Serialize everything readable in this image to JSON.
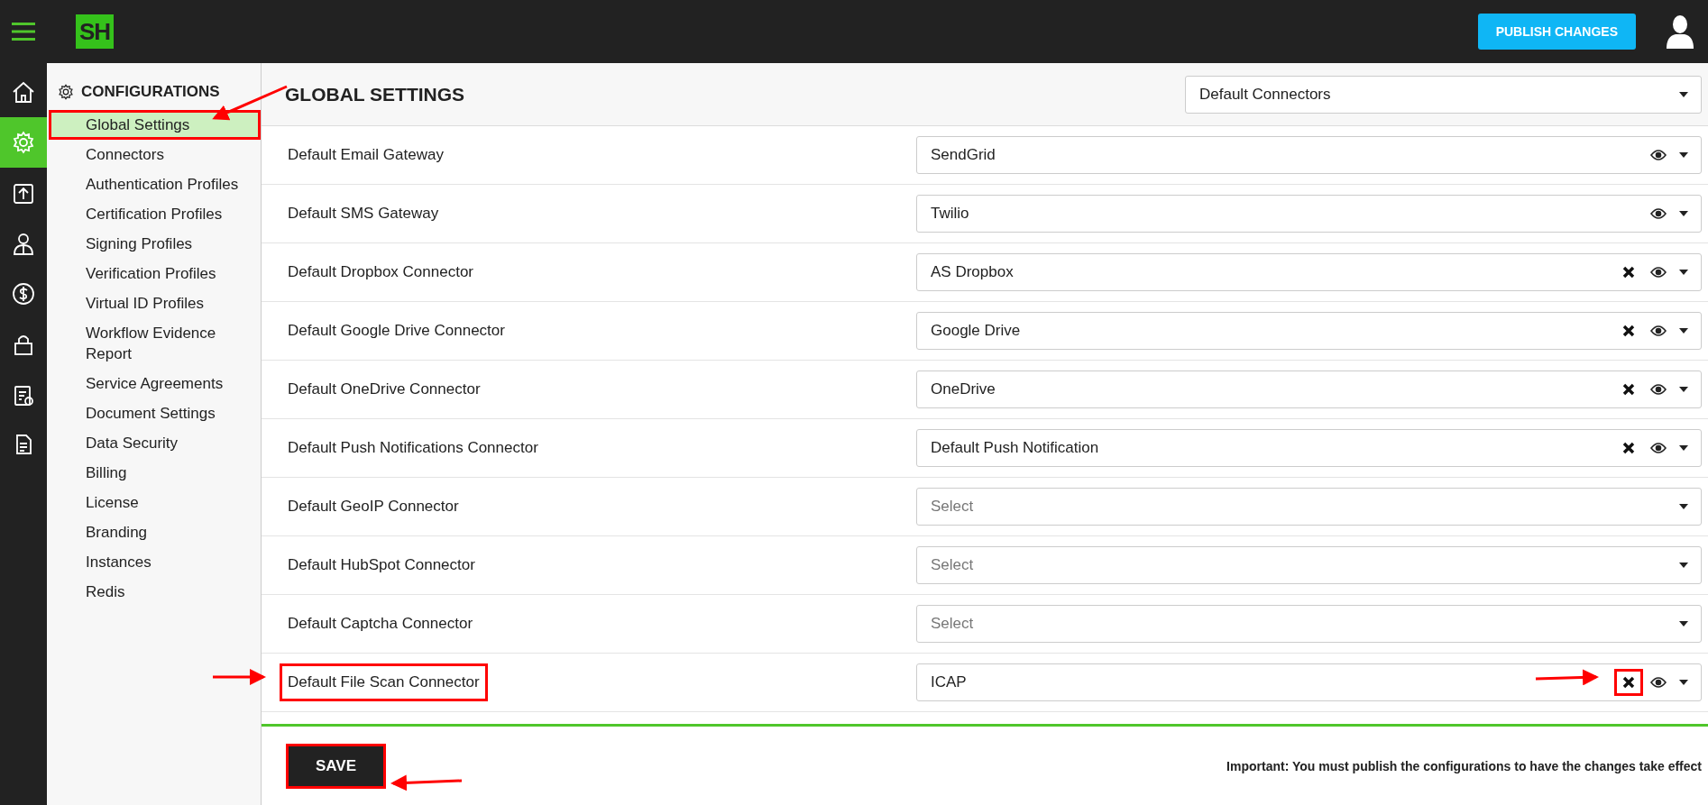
{
  "topbar": {
    "logo": "SH",
    "publish_button": "PUBLISH CHANGES"
  },
  "rail": [
    {
      "selected": false
    },
    {
      "selected": true
    },
    {
      "selected": false
    },
    {
      "selected": false
    },
    {
      "selected": false
    },
    {
      "selected": false
    },
    {
      "selected": false
    },
    {
      "selected": false
    }
  ],
  "sidebar": {
    "title": "CONFIGURATIONS",
    "items": [
      {
        "label": "Global Settings",
        "selected": true,
        "annotated": true
      },
      {
        "label": "Connectors",
        "selected": false,
        "annotated": false
      },
      {
        "label": "Authentication Profiles",
        "selected": false,
        "annotated": false
      },
      {
        "label": "Certification Profiles",
        "selected": false,
        "annotated": false
      },
      {
        "label": "Signing Profiles",
        "selected": false,
        "annotated": false
      },
      {
        "label": "Verification Profiles",
        "selected": false,
        "annotated": false
      },
      {
        "label": "Virtual ID Profiles",
        "selected": false,
        "annotated": false
      },
      {
        "label": "Workflow Evidence Report",
        "selected": false,
        "annotated": false
      },
      {
        "label": "Service Agreements",
        "selected": false,
        "annotated": false
      },
      {
        "label": "Document Settings",
        "selected": false,
        "annotated": false
      },
      {
        "label": "Data Security",
        "selected": false,
        "annotated": false
      },
      {
        "label": "Billing",
        "selected": false,
        "annotated": false
      },
      {
        "label": "License",
        "selected": false,
        "annotated": false
      },
      {
        "label": "Branding",
        "selected": false,
        "annotated": false
      },
      {
        "label": "Instances",
        "selected": false,
        "annotated": false
      },
      {
        "label": "Redis",
        "selected": false,
        "annotated": false
      }
    ]
  },
  "page": {
    "title": "GLOBAL SETTINGS",
    "category_select": "Default Connectors"
  },
  "rows": [
    {
      "label": "Default Email Gateway",
      "value": "SendGrid",
      "clearable": false,
      "previewable": true,
      "annotated": false
    },
    {
      "label": "Default SMS Gateway",
      "value": "Twilio",
      "clearable": false,
      "previewable": true,
      "annotated": false
    },
    {
      "label": "Default Dropbox Connector",
      "value": "AS Dropbox",
      "clearable": true,
      "previewable": true,
      "annotated": false,
      "clear_annotated": false
    },
    {
      "label": "Default Google Drive Connector",
      "value": "Google Drive",
      "clearable": true,
      "previewable": true,
      "annotated": false,
      "clear_annotated": false
    },
    {
      "label": "Default OneDrive Connector",
      "value": "OneDrive",
      "clearable": true,
      "previewable": true,
      "annotated": false,
      "clear_annotated": false
    },
    {
      "label": "Default Push Notifications Connector",
      "value": "Default Push Notification",
      "clearable": true,
      "previewable": true,
      "annotated": false,
      "clear_annotated": false
    },
    {
      "label": "Default GeoIP Connector",
      "placeholder": "Select",
      "clearable": false,
      "previewable": false,
      "annotated": false
    },
    {
      "label": "Default HubSpot Connector",
      "placeholder": "Select",
      "clearable": false,
      "previewable": false,
      "annotated": false
    },
    {
      "label": "Default Captcha Connector",
      "placeholder": "Select",
      "clearable": false,
      "previewable": false,
      "annotated": false
    },
    {
      "label": "Default File Scan Connector",
      "value": "ICAP",
      "clearable": true,
      "previewable": true,
      "annotated": true,
      "clear_annotated": true
    }
  ],
  "footer": {
    "save_button": "SAVE",
    "save_annotated": true,
    "notice": "Important: You must publish the configurations to have the changes take effect"
  }
}
